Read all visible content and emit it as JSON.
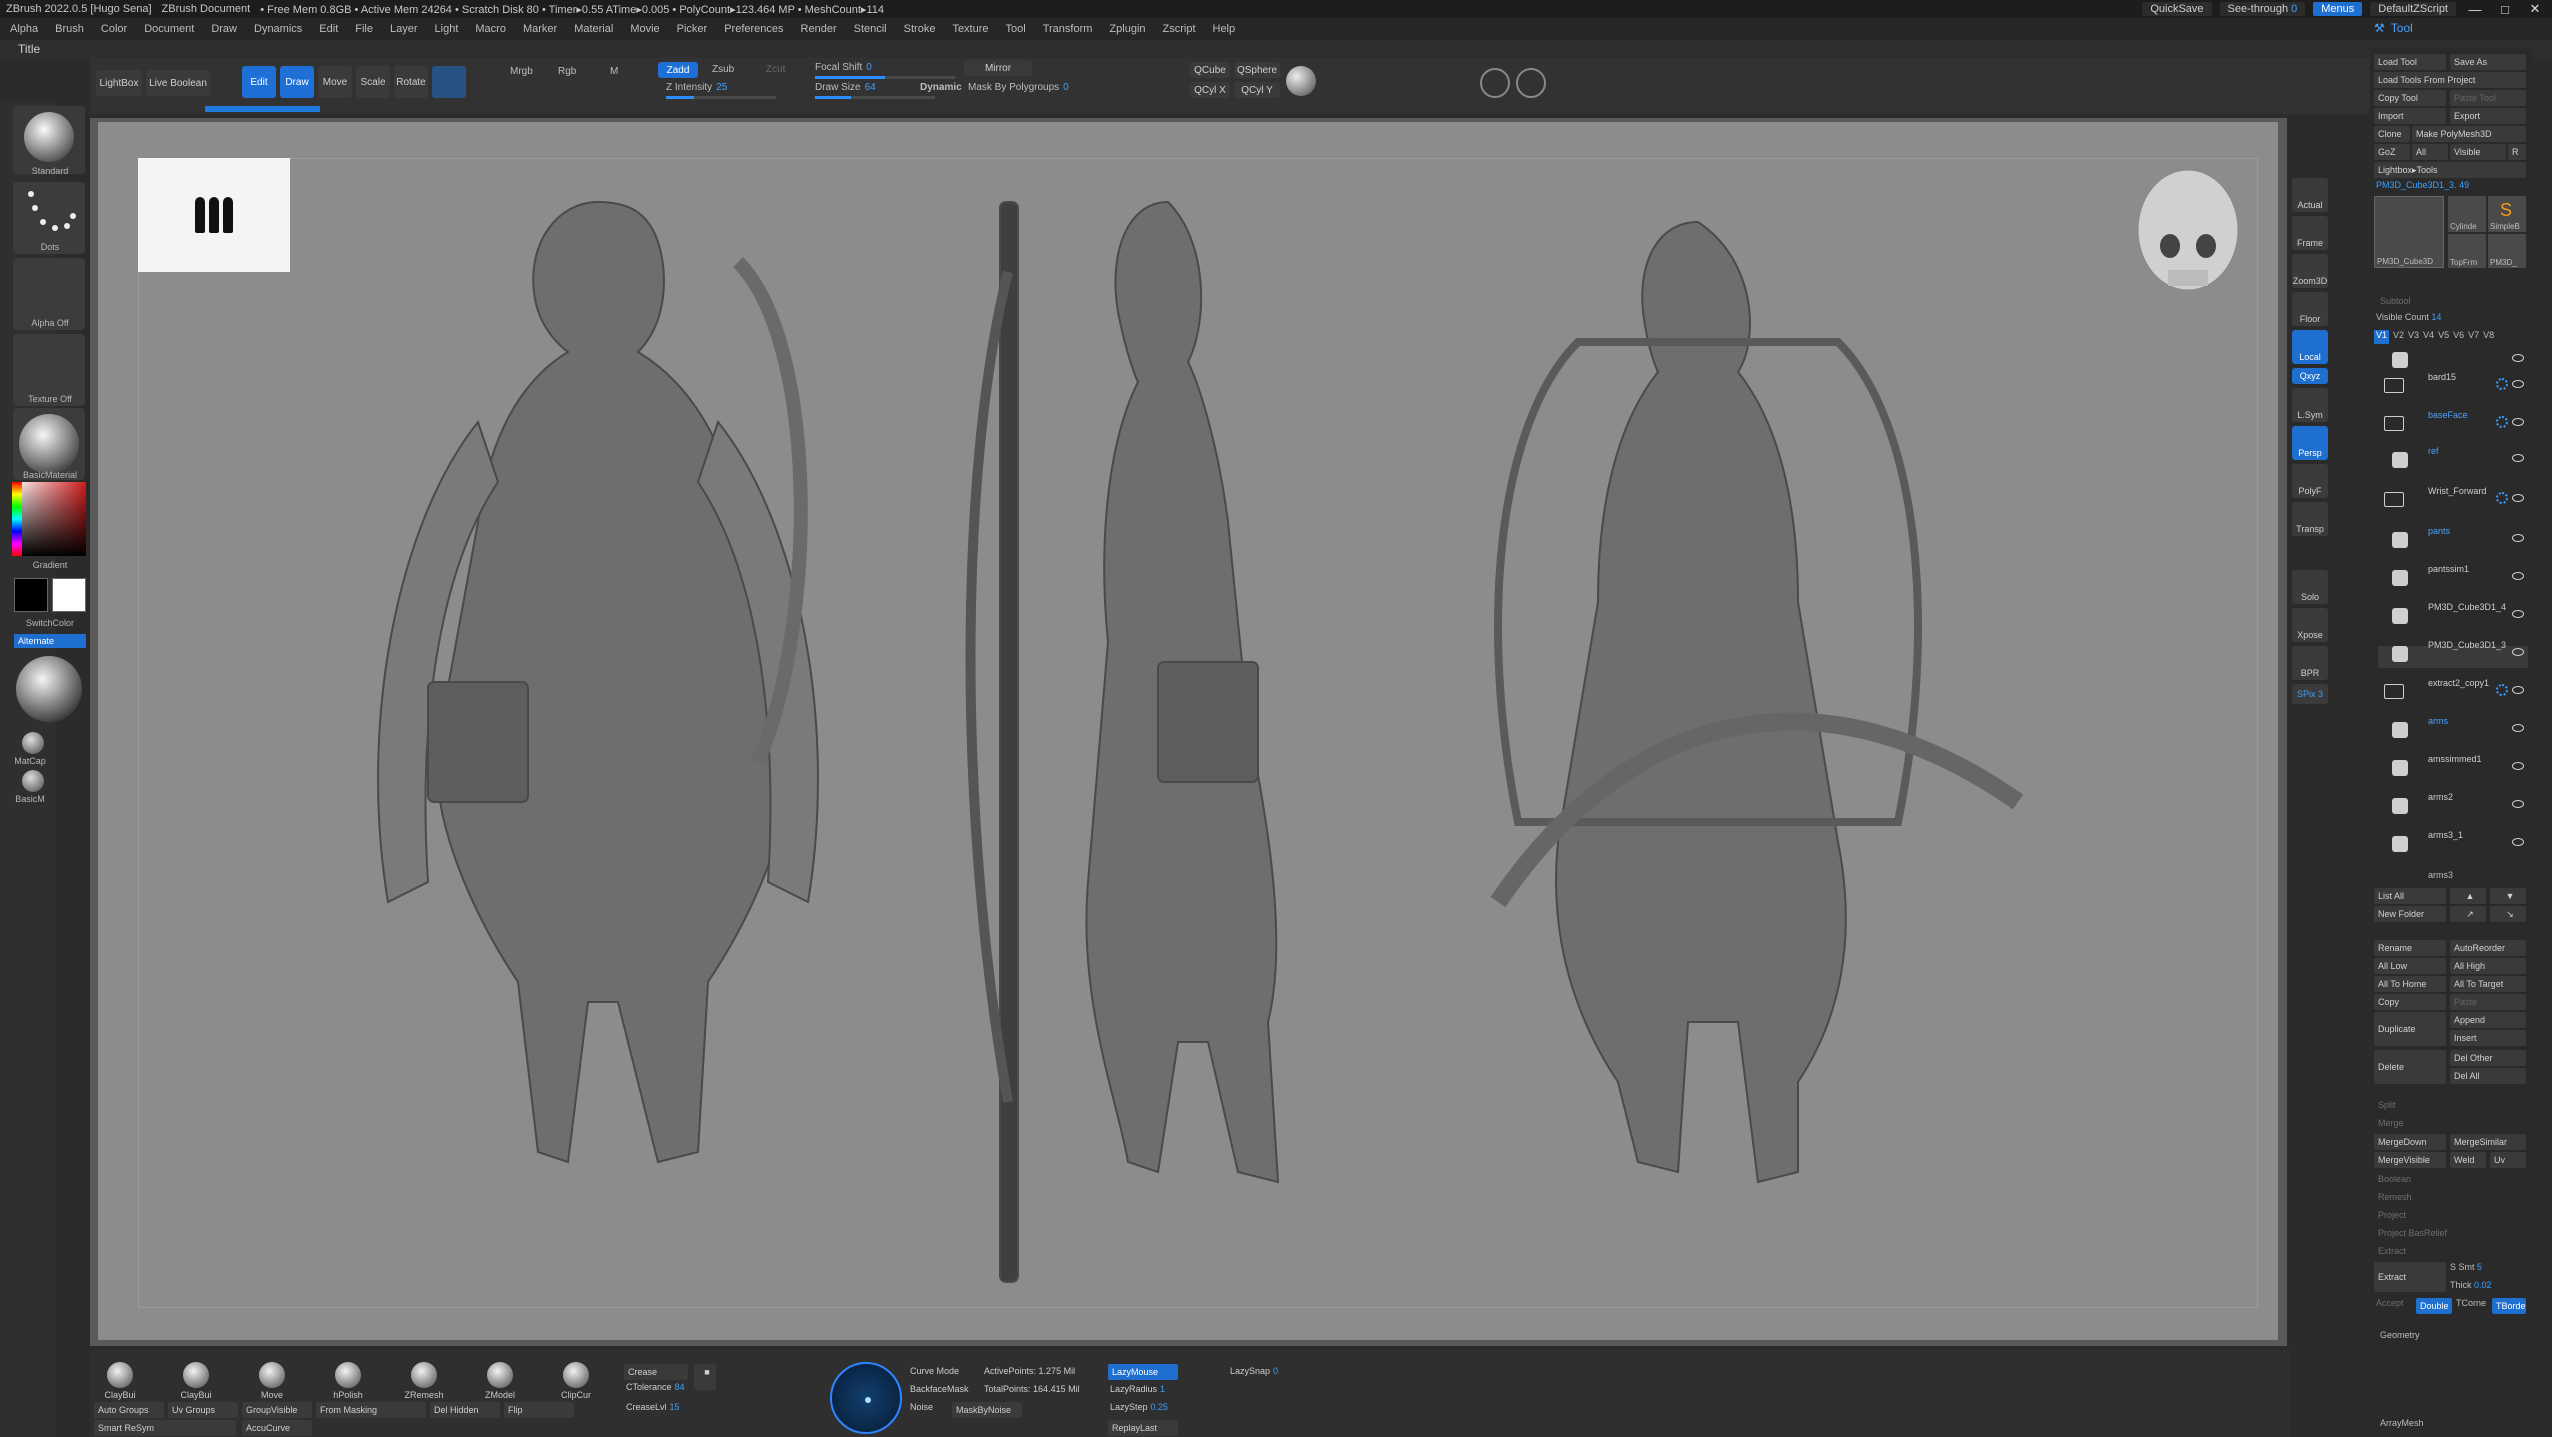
{
  "titlebar": {
    "app": "ZBrush 2022.0.5 [Hugo Sena]",
    "doc": "ZBrush Document",
    "stats": "• Free Mem 0.8GB • Active Mem 24264 • Scratch Disk 80 • Timer▸0.55 ATime▸0.005 • PolyCount▸123.464 MP • MeshCount▸114",
    "quicksave": "QuickSave",
    "seethrough": "See-through",
    "seethrough_val": "0",
    "menus": "Menus",
    "defaultzscript": "DefaultZScript"
  },
  "menubar": {
    "items": [
      "Alpha",
      "Brush",
      "Color",
      "Document",
      "Draw",
      "Dynamics",
      "Edit",
      "File",
      "Layer",
      "Light",
      "Macro",
      "Marker",
      "Material",
      "Movie",
      "Picker",
      "Preferences",
      "Render",
      "Stencil",
      "Stroke",
      "Texture",
      "Tool",
      "Transform",
      "Zplugin",
      "Zscript",
      "Help"
    ],
    "tool_tab": "Tool"
  },
  "titleline": {
    "label": "Title"
  },
  "shelf": {
    "lightbox": "LightBox",
    "live_boolean": "Live Boolean",
    "edit": "Edit",
    "draw": "Draw",
    "move": "Move",
    "scale": "Scale",
    "rotate": "Rotate",
    "mrgb": "Mrgb",
    "rgb": "Rgb",
    "m": "M",
    "zadd": "Zadd",
    "zsub": "Zsub",
    "zcut": "Zcut",
    "z_intensity_label": "Z Intensity",
    "z_intensity": "25",
    "focal_shift_label": "Focal Shift",
    "focal_shift": "0",
    "draw_size_label": "Draw Size",
    "draw_size": "64",
    "dynamic": "Dynamic",
    "mirror": "Mirror",
    "mask_by_polygroups_label": "Mask By Polygroups",
    "mask_by_polygroups": "0",
    "qcube": "QCube",
    "qsphere": "QSphere",
    "qcyl_x": "QCyl X",
    "qcyl_y": "QCyl Y"
  },
  "lefttray": {
    "standard": "Standard",
    "dots": "Dots",
    "alpha_off": "Alpha Off",
    "texture_off": "Texture Off",
    "basic_material": "BasicMaterial",
    "gradient": "Gradient",
    "switch_color": "SwitchColor",
    "alternate": "Alternate",
    "matcap": "MatCap",
    "basicm": "BasicM"
  },
  "nav": {
    "actual": "Actual",
    "frame": "Frame",
    "zoom3d": "Zoom3D",
    "floor": "Floor",
    "local": "Local",
    "xyz": "Qxyz",
    "lsym": "L.Sym",
    "persp": "Persp",
    "polyf": "PolyF",
    "transp": "Transp",
    "solo": "Solo",
    "xpose": "Xpose",
    "bpr": "BPR",
    "spix": "SPix 3"
  },
  "rpanel": {
    "load_tool": "Load Tool",
    "save_as": "Save As",
    "load_from_project": "Load Tools From Project",
    "copy_tool": "Copy Tool",
    "paste_tool": "Paste Tool",
    "import": "Import",
    "export": "Export",
    "clone": "Clone",
    "make_polymesh": "Make PolyMesh3D",
    "goz": "GoZ",
    "all": "All",
    "visible": "Visible",
    "r": "R",
    "lightbox_tools": "Lightbox▸Tools",
    "current_tool": "PM3D_Cube3D1_3.",
    "current_tool_num": "49",
    "tool_thumbs": [
      "PM3D_Cube3D",
      "Cylinde",
      "SimpleB",
      "TopFrm",
      "PM3D_"
    ],
    "subtool": "Subtool",
    "visible_count": "Visible Count",
    "visible_count_val": "14",
    "versions": [
      "V1",
      "V2",
      "V3",
      "V4",
      "V5",
      "V6",
      "V7",
      "V8"
    ],
    "subtools": [
      {
        "name": "bard15",
        "kind": "thumb"
      },
      {
        "name": "baseFace",
        "kind": "folder"
      },
      {
        "name": "ref",
        "kind": "folder"
      },
      {
        "name": "Wrist_Forward",
        "kind": "thumb"
      },
      {
        "name": "pants",
        "kind": "folder"
      },
      {
        "name": "pantssim1",
        "kind": "thumb"
      },
      {
        "name": "PM3D_Cube3D1_4",
        "kind": "thumb"
      },
      {
        "name": "PM3D_Cube3D1_3",
        "kind": "thumb"
      },
      {
        "name": "extract2_copy1",
        "kind": "thumb"
      },
      {
        "name": "arms",
        "kind": "folder"
      },
      {
        "name": "amssimmed1",
        "kind": "thumb"
      },
      {
        "name": "arms2",
        "kind": "thumb"
      },
      {
        "name": "arms3_1",
        "kind": "thumb"
      },
      {
        "name": "arms3",
        "kind": "thumb"
      }
    ],
    "list_all": "List All",
    "new_folder": "New Folder",
    "rename": "Rename",
    "autoreorder": "AutoReorder",
    "all_low": "All Low",
    "all_high": "All High",
    "all_to_home": "All To Home",
    "all_to_target": "All To Target",
    "copy": "Copy",
    "paste": "Paste",
    "duplicate": "Duplicate",
    "append": "Append",
    "insert": "Insert",
    "delete": "Delete",
    "del_other": "Del Other",
    "del_all": "Del All",
    "split": "Split",
    "merge": "Merge",
    "merge_down": "MergeDown",
    "merge_similar": "MergeSimilar",
    "merge_visible": "MergeVisible",
    "weld": "Weld",
    "uv": "Uv",
    "boolean": "Boolean",
    "remesh": "Remesh",
    "project": "Project",
    "project_bas": "Project BasRelief",
    "extract_section": "Extract",
    "extract": "Extract",
    "smt": "S Smt",
    "smt_val": "5",
    "thick": "Thick",
    "thick_val": "0.02",
    "accept": "Accept",
    "double": "Double",
    "tcorne": "TCorne",
    "tborder": "TBorder",
    "geometry": "Geometry",
    "arraymesh": "ArrayMesh"
  },
  "bottom": {
    "brushes": [
      "ClayBui",
      "ClayBui",
      "Move",
      "hPolish",
      "ZRemesh",
      "ZModel",
      "ClipCur"
    ],
    "auto_groups": "Auto Groups",
    "uv_groups": "Uv Groups",
    "group_visible": "GroupVisible",
    "from_masking": "From Masking",
    "del_hidden": "Del Hidden",
    "flip": "Flip",
    "smart_resym": "Smart ReSym",
    "accucurve": "AccuCurve",
    "crease": "Crease",
    "ctolerance_label": "CTolerance",
    "ctolerance": "84",
    "creaselvl_label": "CreaseLvl",
    "creaselvl": "15",
    "curve_mode": "Curve Mode",
    "backface_mask": "BackfaceMask",
    "noise": "Noise",
    "mask_by_noise": "MaskByNoise",
    "active_points_label": "ActivePoints:",
    "active_points": "1.275 Mil",
    "total_points_label": "TotalPoints:",
    "total_points": "164.415 Mil",
    "lazymouse": "LazyMouse",
    "lazyradius_label": "LazyRadius",
    "lazyradius": "1",
    "lazystep_label": "LazyStep",
    "lazystep": "0.25",
    "replaylast": "ReplayLast",
    "lazysnap_label": "LazySnap",
    "lazysnap": "0"
  },
  "colors": {
    "accent": "#1f6fd0",
    "value_blue": "#3ba0ff",
    "canvas_bg": "#8c8c8c"
  }
}
